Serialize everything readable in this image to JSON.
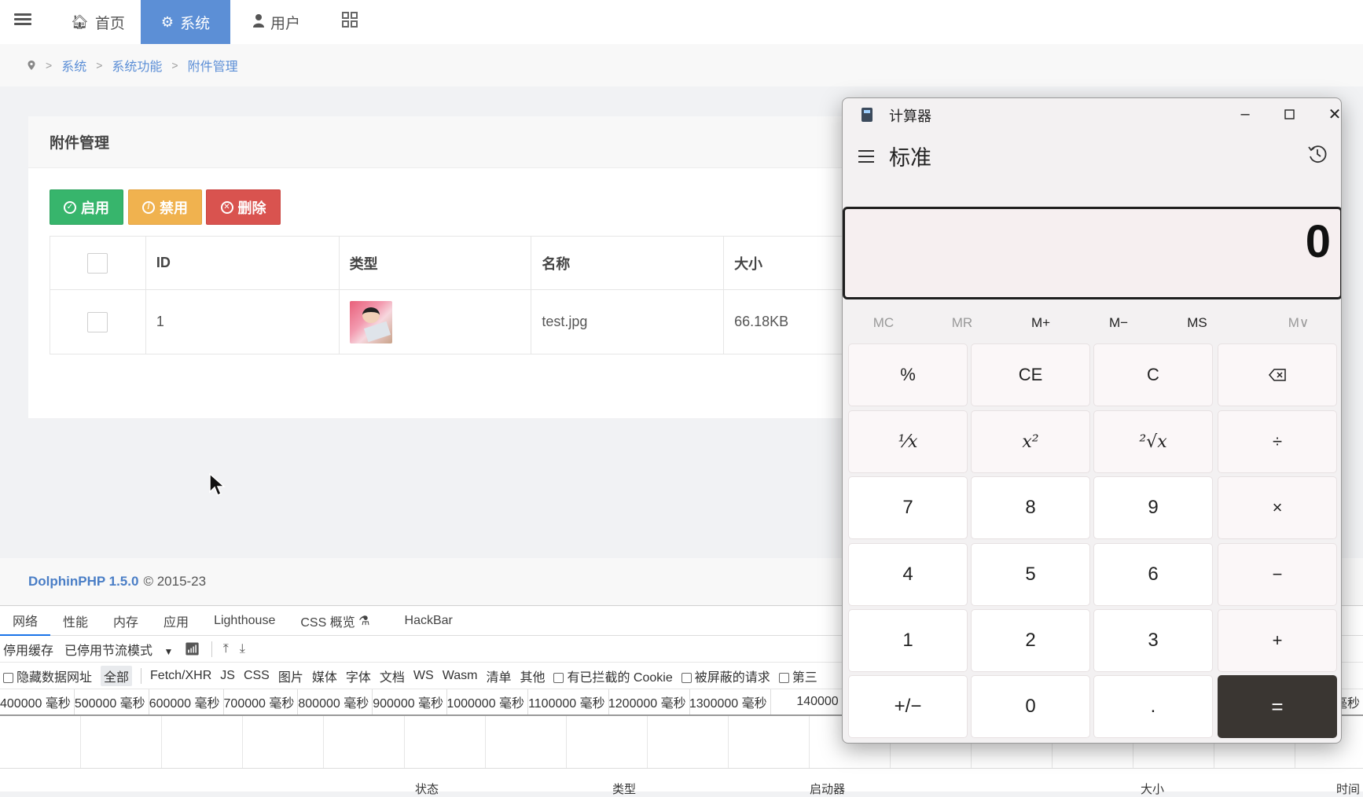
{
  "topnav": {
    "items": [
      {
        "label": "首页",
        "icon": "home-icon"
      },
      {
        "label": "系统",
        "icon": "gear-icon",
        "active": true
      },
      {
        "label": "用户",
        "icon": "user-icon"
      },
      {
        "label": "",
        "icon": "grid-icon"
      }
    ]
  },
  "breadcrumb": [
    "系统",
    "系统功能",
    "附件管理"
  ],
  "panel": {
    "title": "附件管理",
    "buttons": {
      "enable": "启用",
      "disable": "禁用",
      "delete": "删除"
    },
    "columns": [
      "ID",
      "类型",
      "名称",
      "大小"
    ],
    "rows": [
      {
        "id": "1",
        "type_icon": "image-thumbnail-icon",
        "name": "test.jpg",
        "size": "66.18KB"
      }
    ]
  },
  "footer": {
    "brand": "DolphinPHP 1.5.0",
    "copyright": "© 2015-23"
  },
  "devtools": {
    "tabs": [
      "网络",
      "性能",
      "内存",
      "应用",
      "Lighthouse",
      "CSS 概览",
      "HackBar"
    ],
    "toolbar": {
      "disable_cache": "停用缓存",
      "throttle": "已停用节流模式"
    },
    "filters": {
      "hide_data_urls": "隐藏数据网址",
      "all": "全部",
      "types": [
        "Fetch/XHR",
        "JS",
        "CSS",
        "图片",
        "媒体",
        "字体",
        "文档",
        "WS",
        "Wasm",
        "清单",
        "其他"
      ],
      "blocked_cookies": "有已拦截的 Cookie",
      "blocked_requests": "被屏蔽的请求",
      "third_party": "第三"
    },
    "ticks": [
      "400000 毫秒",
      "500000 毫秒",
      "600000 毫秒",
      "700000 毫秒",
      "800000 毫秒",
      "900000 毫秒",
      "1000000 毫秒",
      "1100000 毫秒",
      "1200000 毫秒",
      "1300000 毫秒",
      "140000"
    ],
    "tick_right": "毫秒",
    "column_headers": [
      "状态",
      "类型",
      "启动器",
      "大小",
      "时间"
    ]
  },
  "calculator": {
    "title": "计算器",
    "mode": "标准",
    "display": "0",
    "memory": [
      "MC",
      "MR",
      "M+",
      "M−",
      "MS",
      "M∨"
    ],
    "keys": [
      [
        "%",
        "CE",
        "C",
        "⌫"
      ],
      [
        "⅟x",
        "x²",
        "²√x",
        "÷"
      ],
      [
        "7",
        "8",
        "9",
        "×"
      ],
      [
        "4",
        "5",
        "6",
        "−"
      ],
      [
        "1",
        "2",
        "3",
        "+"
      ],
      [
        "+/−",
        "0",
        ".",
        "="
      ]
    ]
  }
}
